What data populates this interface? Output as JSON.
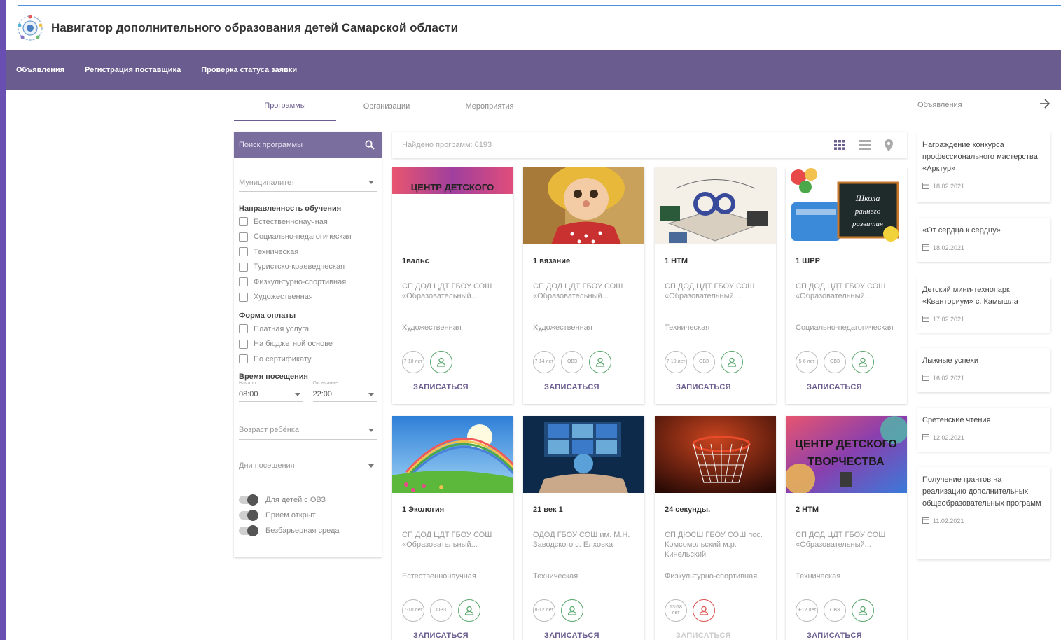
{
  "header": {
    "title": "Навигатор дополнительного образования детей Самарской области"
  },
  "nav": {
    "items": [
      "Объявления",
      "Регистрация поставщика",
      "Проверка статуса заявки"
    ]
  },
  "tabs": [
    "Программы",
    "Организации",
    "Мероприятия"
  ],
  "search": {
    "placeholder": "Поиск программы"
  },
  "filters": {
    "municipality": "Муниципалитет",
    "direction_title": "Направленность обучения",
    "directions": [
      "Естественнонаучная",
      "Социально-педагогическая",
      "Техническая",
      "Туристско-краеведческая",
      "Физкультурно-спортивная",
      "Художественная"
    ],
    "payment_title": "Форма оплаты",
    "payments": [
      "Платная услуга",
      "На бюджетной основе",
      "По сертификату"
    ],
    "time_title": "Время посещения",
    "time_start_label": "Начало",
    "time_start": "08:00",
    "time_end_label": "Окончание",
    "time_end": "22:00",
    "age": "Возраст ребёнка",
    "days": "Дни посещения",
    "toggles": [
      "Для детей с ОВЗ",
      "Прием открыт",
      "Безбарьерная среда"
    ]
  },
  "results": {
    "text": "Найдено программ: 6193"
  },
  "enroll_label": "ЗАПИСАТЬСЯ",
  "cards": [
    {
      "title": "1вальс",
      "org": "СП ДОД ЦДТ ГБОУ СОШ «Образовательный...",
      "direction": "Художественная",
      "age": "7-10 лет",
      "ovz": ""
    },
    {
      "title": "1 вязание",
      "org": "СП ДОД ЦДТ ГБОУ СОШ «Образовательный...",
      "direction": "Художественная",
      "age": "7-14 лет",
      "ovz": "ОВЗ"
    },
    {
      "title": "1 НТМ",
      "org": "СП ДОД ЦДТ ГБОУ СОШ «Образовательный...",
      "direction": "Техническая",
      "age": "7-10 лет",
      "ovz": "ОВЗ"
    },
    {
      "title": "1 ШРР",
      "org": "СП ДОД ЦДТ ГБОУ СОШ «Образовательный...",
      "direction": "Социально-педагогическая",
      "age": "5-6 лет",
      "ovz": "ОВЗ"
    },
    {
      "title": "1 Экология",
      "org": "СП ДОД ЦДТ ГБОУ СОШ «Образовательный...",
      "direction": "Естественнонаучная",
      "age": "7-10 лет",
      "ovz": "ОВЗ"
    },
    {
      "title": "21 век 1",
      "org": "ОДОД ГБОУ СОШ им. М.Н. Заводского с. Елховка",
      "direction": "Техническая",
      "age": "8-12 лет",
      "ovz": ""
    },
    {
      "title": "24 секунды.",
      "org": "СП ДЮСШ ГБОУ СОШ пос. Комсомольский м.р. Кинельский",
      "direction": "Физкультурно-спортивная",
      "age": "13-18 лет",
      "ovz": ""
    },
    {
      "title": "2 НТМ",
      "org": "СП ДОД ЦДТ ГБОУ СОШ «Образовательный...",
      "direction": "Техническая",
      "age": "9-12 лет",
      "ovz": "ОВЗ"
    }
  ],
  "card_images": {
    "center_text_1": "ЦЕНТР ДЕТСКОГО",
    "center_text_2": "ТВОРЧЕСТВА",
    "school_text_1": "Школа",
    "school_text_2": "раннего",
    "school_text_3": "развития"
  },
  "announcements": {
    "title": "Объявления",
    "items": [
      {
        "title": "Награждение конкурса профессионального мастерства «Арктур»",
        "date": "18.02.2021"
      },
      {
        "title": "«От сердца к сердцу»",
        "date": "18.02.2021"
      },
      {
        "title": "Детский мини-технопарк «Кванториум» с. Камышла",
        "date": "17.02.2021"
      },
      {
        "title": "Лыжные успехи",
        "date": "16.02.2021"
      },
      {
        "title": "Сретенские чтения",
        "date": "12.02.2021"
      },
      {
        "title": "Получение грантов на реализацию дополнительных общеобразовательных программ",
        "date": "11.02.2021"
      }
    ]
  },
  "colors": {
    "accent": "#6b5c8f",
    "nav_bg": "#6b5c8f",
    "search_bg": "#7a6e9e",
    "success": "#5aa86e",
    "danger": "#d9534f"
  }
}
